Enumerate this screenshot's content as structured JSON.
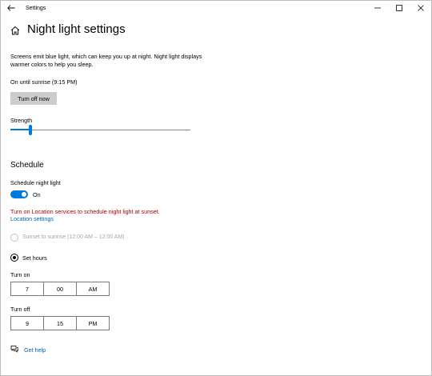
{
  "window": {
    "title": "Settings"
  },
  "page": {
    "title": "Night light settings",
    "description": "Screens emit blue light, which can keep you up at night. Night light displays warmer colors to help you sleep.",
    "status": "On until sunrise (9:15 PM)",
    "turn_off_button": "Turn off now"
  },
  "strength": {
    "label": "Strength",
    "value_fraction": 0.11
  },
  "schedule": {
    "heading": "Schedule",
    "toggle_label": "Schedule night light",
    "toggle_state": "On",
    "warning": "Turn on Location services to schedule night light at sunset.",
    "location_link": "Location settings",
    "option_sunset": "Sunset to sunrise (12:00 AM – 12:00 AM)",
    "option_set_hours": "Set hours",
    "selected_option": "Set hours"
  },
  "turn_on": {
    "label": "Turn on",
    "hour": "7",
    "minute": "00",
    "ampm": "AM"
  },
  "turn_off": {
    "label": "Turn off",
    "hour": "9",
    "minute": "15",
    "ampm": "PM"
  },
  "help": {
    "label": "Get help"
  },
  "colors": {
    "accent": "#0078d7",
    "warning": "#a80000",
    "link": "#0063b1"
  }
}
